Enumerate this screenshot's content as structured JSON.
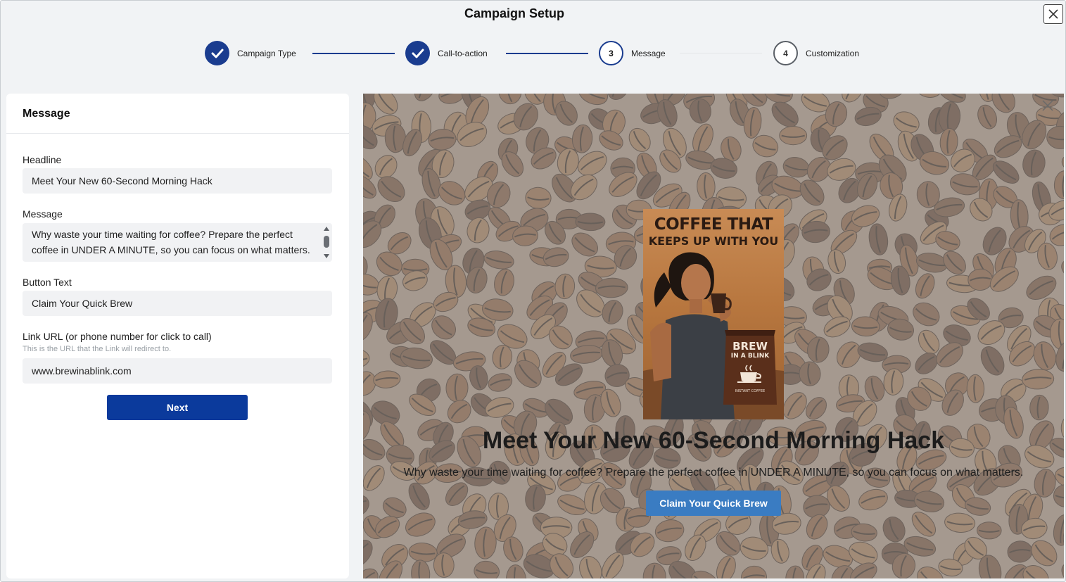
{
  "window": {
    "title": "Campaign Setup",
    "close_icon": "close-icon"
  },
  "stepper": {
    "steps": [
      {
        "label": "Campaign Type",
        "state": "done",
        "number": ""
      },
      {
        "label": "Call-to-action",
        "state": "done",
        "number": ""
      },
      {
        "label": "Message",
        "state": "current",
        "number": "3"
      },
      {
        "label": "Customization",
        "state": "todo",
        "number": "4"
      }
    ],
    "accent_color": "#1a3c8f"
  },
  "form": {
    "title": "Message",
    "headline": {
      "label": "Headline",
      "value": "Meet Your New 60-Second Morning Hack"
    },
    "message": {
      "label": "Message",
      "value": "Why waste your time waiting for coffee? Prepare the perfect coffee in UNDER A MINUTE, so you can focus on what matters."
    },
    "button_text": {
      "label": "Button Text",
      "value": "Claim Your Quick Brew"
    },
    "link_url": {
      "label": "Link URL (or phone number for click to call)",
      "hint": "This is the URL that the Link will redirect to.",
      "value": "www.brewinablink.com"
    },
    "next_label": "Next"
  },
  "preview": {
    "image": {
      "line1": "COFFEE THAT",
      "line2": "KEEPS UP WITH YOU",
      "pack_brand": "BREW",
      "pack_sub": "IN A BLINK",
      "pack_tiny": "INSTANT COFFEE"
    },
    "headline": "Meet Your New 60-Second Morning Hack",
    "message": "Why waste your time waiting for coffee? Prepare the perfect coffee in UNDER A MINUTE, so you can focus on what matters.",
    "button_label": "Claim Your Quick Brew",
    "button_color": "#3a7cc2"
  }
}
